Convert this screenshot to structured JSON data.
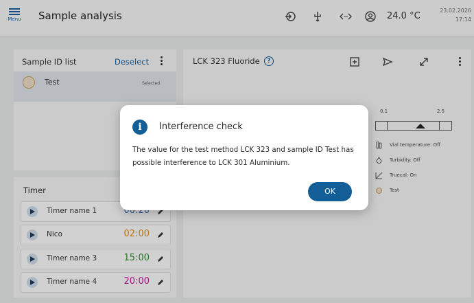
{
  "header": {
    "menu_label": "Menu",
    "title": "Sample analysis",
    "temperature": "24.0 °C",
    "date": "23.02.2026",
    "time": "17:14",
    "status_icons": [
      "login-icon",
      "usb-icon",
      "network-icon",
      "user-icon"
    ]
  },
  "sample_list": {
    "title": "Sample ID list",
    "deselect_label": "Deselect",
    "items": [
      {
        "name": "Test",
        "status": "Selected"
      }
    ]
  },
  "timer": {
    "title": "Timer",
    "rows": [
      {
        "name": "Timer name 1",
        "time": "00:20",
        "color": "#2f63b3"
      },
      {
        "name": "Nico",
        "time": "02:00",
        "color": "#e08a14"
      },
      {
        "name": "Timer name 3",
        "time": "15:00",
        "color": "#2e8b2e"
      },
      {
        "name": "Timer name 4",
        "time": "20:00",
        "color": "#c2189f"
      }
    ]
  },
  "method": {
    "title": "LCK 323 Fluoride",
    "scale_min": "0.1",
    "scale_max": "2.5",
    "info": [
      {
        "icon": "vial-icon",
        "text": "Vial temperature: Off"
      },
      {
        "icon": "turbidity-icon",
        "text": "Turbidity: Off"
      },
      {
        "icon": "truecal-icon",
        "text": "Truecal: On"
      },
      {
        "icon": "sample-dot-icon",
        "text": "Test"
      }
    ]
  },
  "dialog": {
    "title": "Interference check",
    "message": "The value for the test method LCK 323 and sample ID Test has possible interference to LCK 301 Aluminium.",
    "ok_label": "OK"
  },
  "colors": {
    "accent": "#135e96",
    "background": "#e6e7e8"
  }
}
